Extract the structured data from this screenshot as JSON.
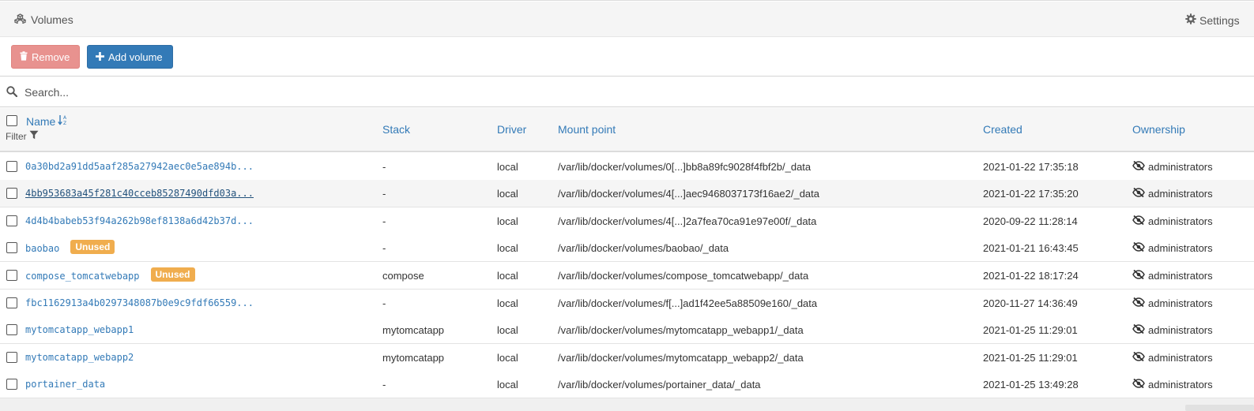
{
  "header": {
    "title": "Volumes",
    "settings_label": "Settings"
  },
  "actions": {
    "remove_label": "Remove",
    "add_label": "Add volume"
  },
  "search": {
    "placeholder": "Search..."
  },
  "table": {
    "columns": {
      "name": "Name",
      "filter": "Filter",
      "stack": "Stack",
      "driver": "Driver",
      "mount": "Mount point",
      "created": "Created",
      "ownership": "Ownership"
    },
    "rows": [
      {
        "name": "0a30bd2a91dd5aaf285a27942aec0e5ae894b...",
        "badge": "",
        "stack": "-",
        "driver": "local",
        "mount": "/var/lib/docker/volumes/0[...]bb8a89fc9028f4fbf2b/_data",
        "created": "2021-01-22 17:35:18",
        "ownership": "administrators"
      },
      {
        "name": "4bb953683a45f281c40cceb85287490dfd03a...",
        "badge": "",
        "stack": "-",
        "driver": "local",
        "mount": "/var/lib/docker/volumes/4[...]aec9468037173f16ae2/_data",
        "created": "2021-01-22 17:35:20",
        "ownership": "administrators"
      },
      {
        "name": "4d4b4babeb53f94a262b98ef8138a6d42b37d...",
        "badge": "",
        "stack": "-",
        "driver": "local",
        "mount": "/var/lib/docker/volumes/4[...]2a7fea70ca91e97e00f/_data",
        "created": "2020-09-22 11:28:14",
        "ownership": "administrators"
      },
      {
        "name": "baobao",
        "badge": "Unused",
        "stack": "-",
        "driver": "local",
        "mount": "/var/lib/docker/volumes/baobao/_data",
        "created": "2021-01-21 16:43:45",
        "ownership": "administrators"
      },
      {
        "name": "compose_tomcatwebapp",
        "badge": "Unused",
        "stack": "compose",
        "driver": "local",
        "mount": "/var/lib/docker/volumes/compose_tomcatwebapp/_data",
        "created": "2021-01-22 18:17:24",
        "ownership": "administrators"
      },
      {
        "name": "fbc1162913a4b0297348087b0e9c9fdf66559...",
        "badge": "",
        "stack": "-",
        "driver": "local",
        "mount": "/var/lib/docker/volumes/f[...]ad1f42ee5a88509e160/_data",
        "created": "2020-11-27 14:36:49",
        "ownership": "administrators"
      },
      {
        "name": "mytomcatapp_webapp1",
        "badge": "",
        "stack": "mytomcatapp",
        "driver": "local",
        "mount": "/var/lib/docker/volumes/mytomcatapp_webapp1/_data",
        "created": "2021-01-25 11:29:01",
        "ownership": "administrators"
      },
      {
        "name": "mytomcatapp_webapp2",
        "badge": "",
        "stack": "mytomcatapp",
        "driver": "local",
        "mount": "/var/lib/docker/volumes/mytomcatapp_webapp2/_data",
        "created": "2021-01-25 11:29:01",
        "ownership": "administrators"
      },
      {
        "name": "portainer_data",
        "badge": "",
        "stack": "-",
        "driver": "local",
        "mount": "/var/lib/docker/volumes/portainer_data/_data",
        "created": "2021-01-25 13:49:28",
        "ownership": "administrators"
      }
    ]
  },
  "colors": {
    "link": "#337ab7",
    "badge_unused": "#f0ad4e",
    "remove_button": "#e8928f",
    "add_button": "#337ab7"
  },
  "icons": {
    "title": "cubes-icon",
    "settings": "gear-icon",
    "remove": "trash-icon",
    "add": "plus-icon",
    "search": "search-icon",
    "sort": "sort-alpha-icon",
    "filter": "filter-icon",
    "ownership": "eye-slash-icon"
  }
}
